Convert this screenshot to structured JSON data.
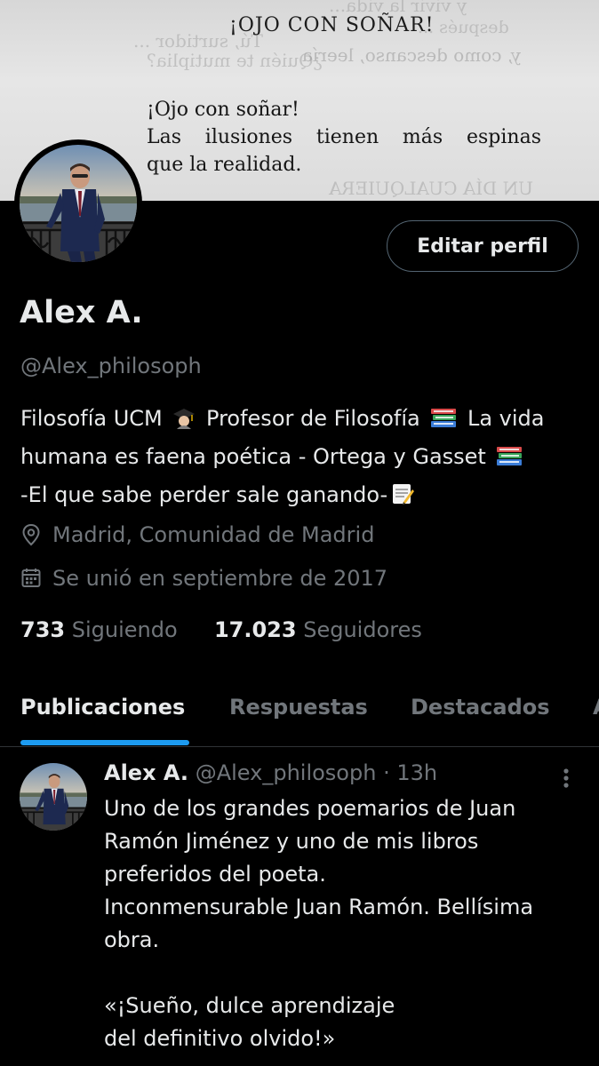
{
  "banner": {
    "title": "¡OJO CON SOÑAR!",
    "quote_lines": [
      "¡Ojo con soñar!",
      "Las ilusiones tienen más espinas",
      "que la realidad."
    ],
    "bleed_through": [
      "y vivir la vida...",
      "después ...",
      "Tú, surtidor ...",
      "¿Quién te mutiplia?",
      "y, como descanso, leería",
      "UN DÍA CUALQUIERA"
    ]
  },
  "profile": {
    "edit_button": "Editar perfil",
    "name": "Alex A.",
    "handle": "@Alex_philosoph",
    "bio_lines": [
      {
        "text": "Filosofía UCM ",
        "emoji": "graduate",
        "text2": " Profesor de Filosofía ",
        "emoji2": "books",
        "text3": " La vida"
      },
      {
        "text": "humana es faena poética - Ortega y Gasset ",
        "emoji": "books"
      },
      {
        "text": "-El que sabe perder sale ganando-",
        "emoji": "memo"
      }
    ],
    "location": "Madrid, Comunidad de Madrid",
    "joined": "Se unió en septiembre de 2017",
    "following_count": "733",
    "following_label": "Siguiendo",
    "followers_count": "17.023",
    "followers_label": "Seguidores"
  },
  "tabs": [
    {
      "label": "Publicaciones",
      "active": true
    },
    {
      "label": "Respuestas",
      "active": false
    },
    {
      "label": "Destacados",
      "active": false
    },
    {
      "label": "A",
      "active": false
    }
  ],
  "post": {
    "author": "Alex A.",
    "handle": "@Alex_philosoph",
    "separator": "·",
    "time": "13h",
    "lines": [
      "Uno de los grandes poemarios de Juan",
      "Ramón Jiménez y uno de mis libros",
      "preferidos del poeta.",
      "Inconmensurable Juan Ramón. Bellísima",
      "obra.",
      "",
      "«¡Sueño, dulce aprendizaje",
      "del definitivo olvido!»"
    ]
  },
  "icons": {
    "location": "location-pin-icon",
    "calendar": "calendar-icon",
    "more": "more-vertical-icon"
  },
  "colors": {
    "background": "#000000",
    "text": "#e7e9ea",
    "muted": "#71767b",
    "accent": "#1d9bf0",
    "border": "#2f3336"
  }
}
